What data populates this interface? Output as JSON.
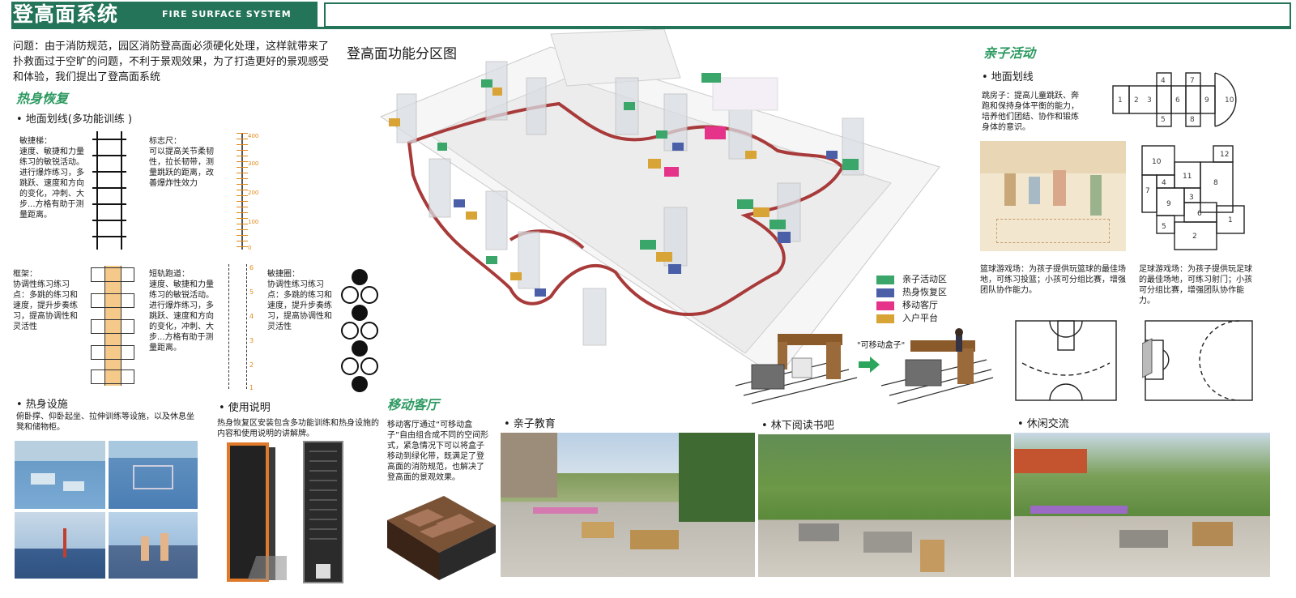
{
  "header": {
    "title": "登高面系统",
    "subtitle_en": "FIRE SURFACE SYSTEM"
  },
  "intro": "问题：由于消防规范，园区消防登高面必须硬化处理，这样就带来了扑救面过于空旷的问题，不利于景观效果，为了打造更好的景观感受和体验，我们提出了登高面系统",
  "warmup": {
    "heading": "热身恢复",
    "ground_lines": "• 地面划线(多功能训练 )",
    "agility_ladder": "敏捷梯：\n速度、敏捷和力量练习的敏锐活动。进行爆炸练习，多跳跃、速度和方向的变化，冲刺、大步...方格有助于测量距离。",
    "marker_ruler": "标志尺：\n可以提高关节柔韧性，拉长韧带，测量跳跃的距离，改善爆炸性效力",
    "frame": "框架：\n协调性练习练习点：多跳的练习和速度，提升步奏练习，提高协调性和灵活性",
    "short_track": "短轨跑道：\n速度、敏捷和力量练习的敏锐活动。进行爆炸练习，多跳跃、速度和方向的变化，冲刺、大步...方格有助于测量距离。",
    "agility_circles": "敏捷圈：\n协调性练习练习点：多跳的练习和速度，提升步奏练习，提高协调性和灵活性",
    "ruler_ticks": [
      "400",
      "300",
      "200",
      "100",
      "0"
    ],
    "track_ticks": [
      "6",
      "5",
      "4",
      "3",
      "2",
      "1"
    ],
    "facilities_heading": "• 热身设施",
    "facilities_text": "俯卧撑、仰卧起坐、拉伸训练等设施，以及休息坐凳和储物柜。",
    "usage_heading": "• 使用说明",
    "usage_text": "热身恢复区安装包含多功能训练和热身设施的内容和使用说明的讲解牌。"
  },
  "plan": {
    "title": "登高面功能分区图",
    "legend": [
      {
        "label": "亲子活动区",
        "color": "#3aa66a"
      },
      {
        "label": "热身恢复区",
        "color": "#4a5fa8"
      },
      {
        "label": "移动客厅",
        "color": "#e6338a"
      },
      {
        "label": "入户平台",
        "color": "#d9a436"
      }
    ],
    "movable_box": "\"可移动盒子\""
  },
  "mobile_lounge": {
    "heading": "移动客厅",
    "text": "移动客厅通过“可移动盒子”自由组合成不同的空间形式，紧急情况下可以将盒子移动到绿化带，既满足了登高面的消防规范，也解决了登高面的景观效果。"
  },
  "parent_child": {
    "heading": "亲子活动",
    "ground_lines": "• 地面划线",
    "hopscotch": "跳房子：提高儿童跳跃、奔跑和保持身体平衡的能力，培养他们团结、协作和锻炼身体的意识。",
    "hop_numbers": [
      "1",
      "2",
      "3",
      "4",
      "5",
      "6",
      "7",
      "8",
      "9",
      "10"
    ],
    "grid_numbers": [
      "10",
      "12",
      "11",
      "7",
      "4",
      "8",
      "9",
      "3",
      "6",
      "1",
      "5",
      "2"
    ],
    "basketball": "篮球游戏场：为孩子提供玩篮球的最佳场地，可练习投篮；小孩可分组比赛，增强团队协作能力。",
    "football": "足球游戏场：为孩子提供玩足球的最佳场地，可练习射门；小孩可分组比赛，增强团队协作能力。"
  },
  "photos": {
    "education": "• 亲子教育",
    "reading": "• 林下阅读书吧",
    "leisure": "• 休闲交流"
  }
}
